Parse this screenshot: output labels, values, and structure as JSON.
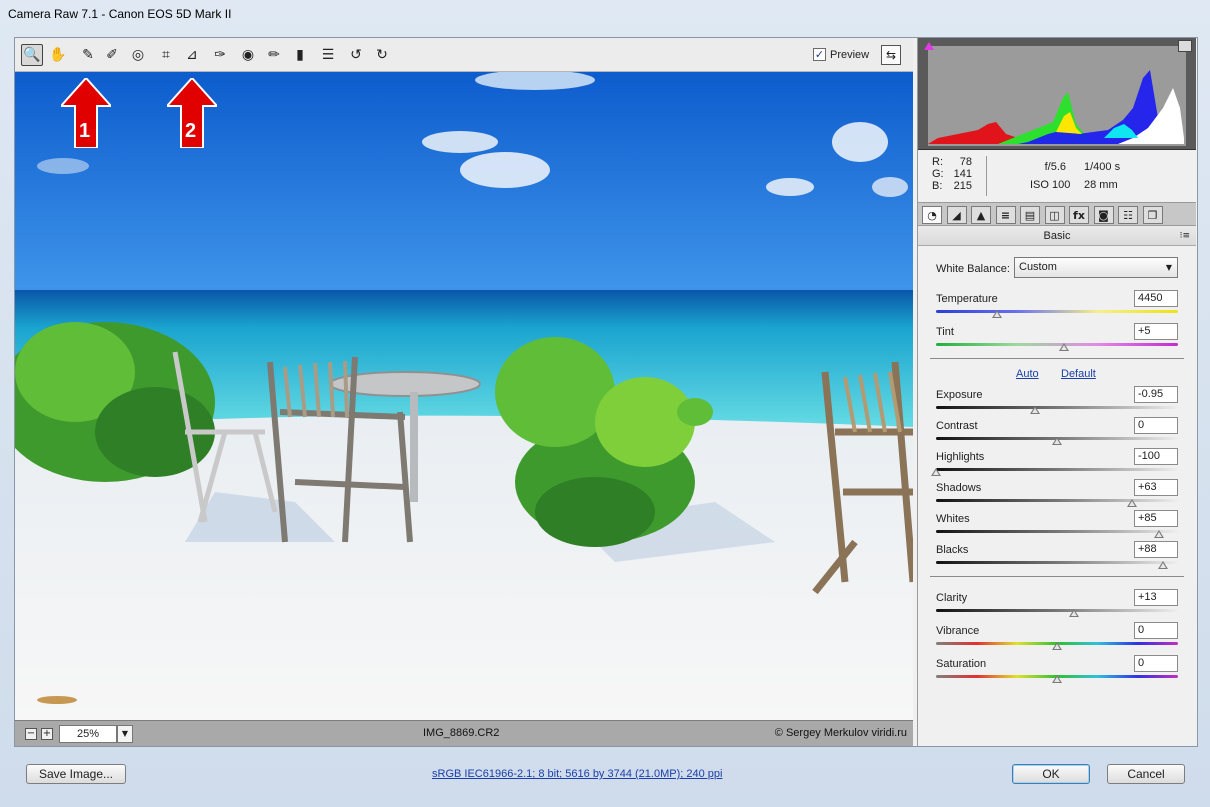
{
  "window": {
    "title": "Camera Raw 7.1  -  Canon EOS 5D Mark II"
  },
  "toolbar": {
    "tools": [
      {
        "name": "zoom-tool",
        "icon": "magnifier-icon",
        "glyph": "🔍"
      },
      {
        "name": "hand-tool",
        "icon": "hand-icon",
        "glyph": "✋"
      },
      {
        "name": "white-balance-tool",
        "icon": "eyedropper-icon",
        "glyph": "✎"
      },
      {
        "name": "color-sampler-tool",
        "icon": "color-sampler-icon",
        "glyph": "✐"
      },
      {
        "name": "targeted-adjustment-tool",
        "icon": "target-icon",
        "glyph": "◎"
      },
      {
        "name": "crop-tool",
        "icon": "crop-icon",
        "glyph": "⌗"
      },
      {
        "name": "straighten-tool",
        "icon": "straighten-icon",
        "glyph": "⊿"
      },
      {
        "name": "spot-removal-tool",
        "icon": "spot-removal-icon",
        "glyph": "✑"
      },
      {
        "name": "red-eye-tool",
        "icon": "red-eye-icon",
        "glyph": "◉"
      },
      {
        "name": "adjustment-brush-tool",
        "icon": "brush-icon",
        "glyph": "✏"
      },
      {
        "name": "graduated-filter-tool",
        "icon": "graduated-filter-icon",
        "glyph": "▮"
      },
      {
        "name": "preferences-tool",
        "icon": "list-icon",
        "glyph": "☰"
      },
      {
        "name": "rotate-ccw-tool",
        "icon": "rotate-left-icon",
        "glyph": "↺"
      },
      {
        "name": "rotate-cw-tool",
        "icon": "rotate-right-icon",
        "glyph": "↻"
      }
    ],
    "preview_label": "Preview",
    "preview_checked": "✓",
    "fullscreen_glyph": "⇆"
  },
  "annotations": {
    "arrow1": "1",
    "arrow2": "2"
  },
  "statusbar": {
    "zoom_minus": "−",
    "zoom_plus": "+",
    "zoom": "25%",
    "zoom_drop": "▼",
    "filename": "IMG_8869.CR2",
    "copyright": "© Sergey Merkulov  viridi.ru"
  },
  "readout": {
    "r_label": "R:",
    "r": "78",
    "g_label": "G:",
    "g": "141",
    "b_label": "B:",
    "b": "215",
    "aperture": "f/5.6",
    "shutter": "1/400 s",
    "iso": "ISO 100",
    "focal": "28 mm"
  },
  "panel_tabs": [
    "◔",
    "◢",
    "▲",
    "≡",
    "▤",
    "◫",
    "fx",
    "◙",
    "☷",
    "❐"
  ],
  "panel": {
    "section_title": "Basic",
    "menu_glyph": "⁝≡",
    "white_balance_label": "White Balance:",
    "white_balance_value": "Custom",
    "dropdown_glyph": "▼",
    "auto_label": "Auto",
    "default_label": "Default"
  },
  "sliders": [
    {
      "id": "temperature",
      "label": "Temperature",
      "value": "4450",
      "position": 0.25,
      "track": "temperature"
    },
    {
      "id": "tint",
      "label": "Tint",
      "value": "+5",
      "position": 0.53,
      "track": "tint"
    },
    {
      "id": "exposure",
      "label": "Exposure",
      "value": "-0.95",
      "position": 0.41,
      "track": "neutral"
    },
    {
      "id": "contrast",
      "label": "Contrast",
      "value": "0",
      "position": 0.5,
      "track": "neutral"
    },
    {
      "id": "highlights",
      "label": "Highlights",
      "value": "-100",
      "position": 0.0,
      "track": "neutral"
    },
    {
      "id": "shadows",
      "label": "Shadows",
      "value": "+63",
      "position": 0.81,
      "track": "neutral"
    },
    {
      "id": "whites",
      "label": "Whites",
      "value": "+85",
      "position": 0.92,
      "track": "neutral"
    },
    {
      "id": "blacks",
      "label": "Blacks",
      "value": "+88",
      "position": 0.94,
      "track": "neutral"
    },
    {
      "id": "clarity",
      "label": "Clarity",
      "value": "+13",
      "position": 0.57,
      "track": "neutral"
    },
    {
      "id": "vibrance",
      "label": "Vibrance",
      "value": "0",
      "position": 0.5,
      "track": "spectrum"
    },
    {
      "id": "saturation",
      "label": "Saturation",
      "value": "0",
      "position": 0.5,
      "track": "spectrum"
    }
  ],
  "footer": {
    "save_label": "Save Image...",
    "file_info": "sRGB IEC61966-2.1; 8 bit; 5616 by 3744 (21.0MP); 240 ppi",
    "ok_label": "OK",
    "cancel_label": "Cancel"
  },
  "colors": {
    "accent_link": "#1a3fa8",
    "annotation_arrow": "#e00000",
    "sky": "#1d6fd8",
    "sea": "#2fc7d6",
    "sand": "#f2f3f4"
  }
}
